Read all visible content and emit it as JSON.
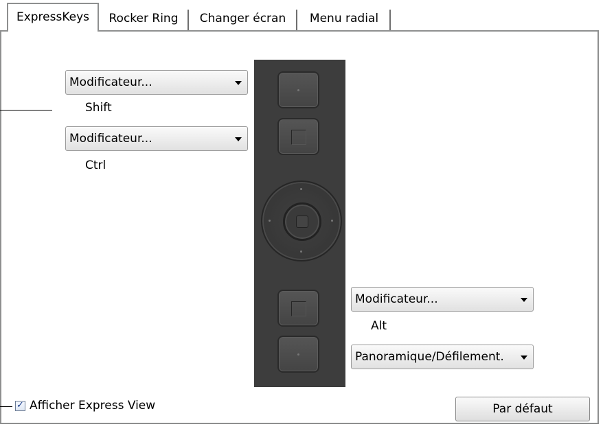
{
  "tabs": [
    {
      "label": "ExpressKeys",
      "active": true
    },
    {
      "label": "Rocker Ring",
      "active": false
    },
    {
      "label": "Changer écran",
      "active": false
    },
    {
      "label": "Menu radial",
      "active": false
    }
  ],
  "keys": {
    "top1": {
      "selected": "Modificateur...",
      "assigned": "Shift"
    },
    "top2": {
      "selected": "Modificateur...",
      "assigned": "Ctrl"
    },
    "bottom1": {
      "selected": "Modificateur...",
      "assigned": "Alt"
    },
    "bottom2": {
      "selected": "Panoramique/Défilement."
    }
  },
  "footer": {
    "checkbox_label": "Afficher Express View",
    "checkbox_checked": true,
    "checkbox_mark": "✓",
    "default_button": "Par défaut"
  },
  "icons": {
    "dropdown": "chevron-down-icon",
    "check": "check-icon"
  }
}
